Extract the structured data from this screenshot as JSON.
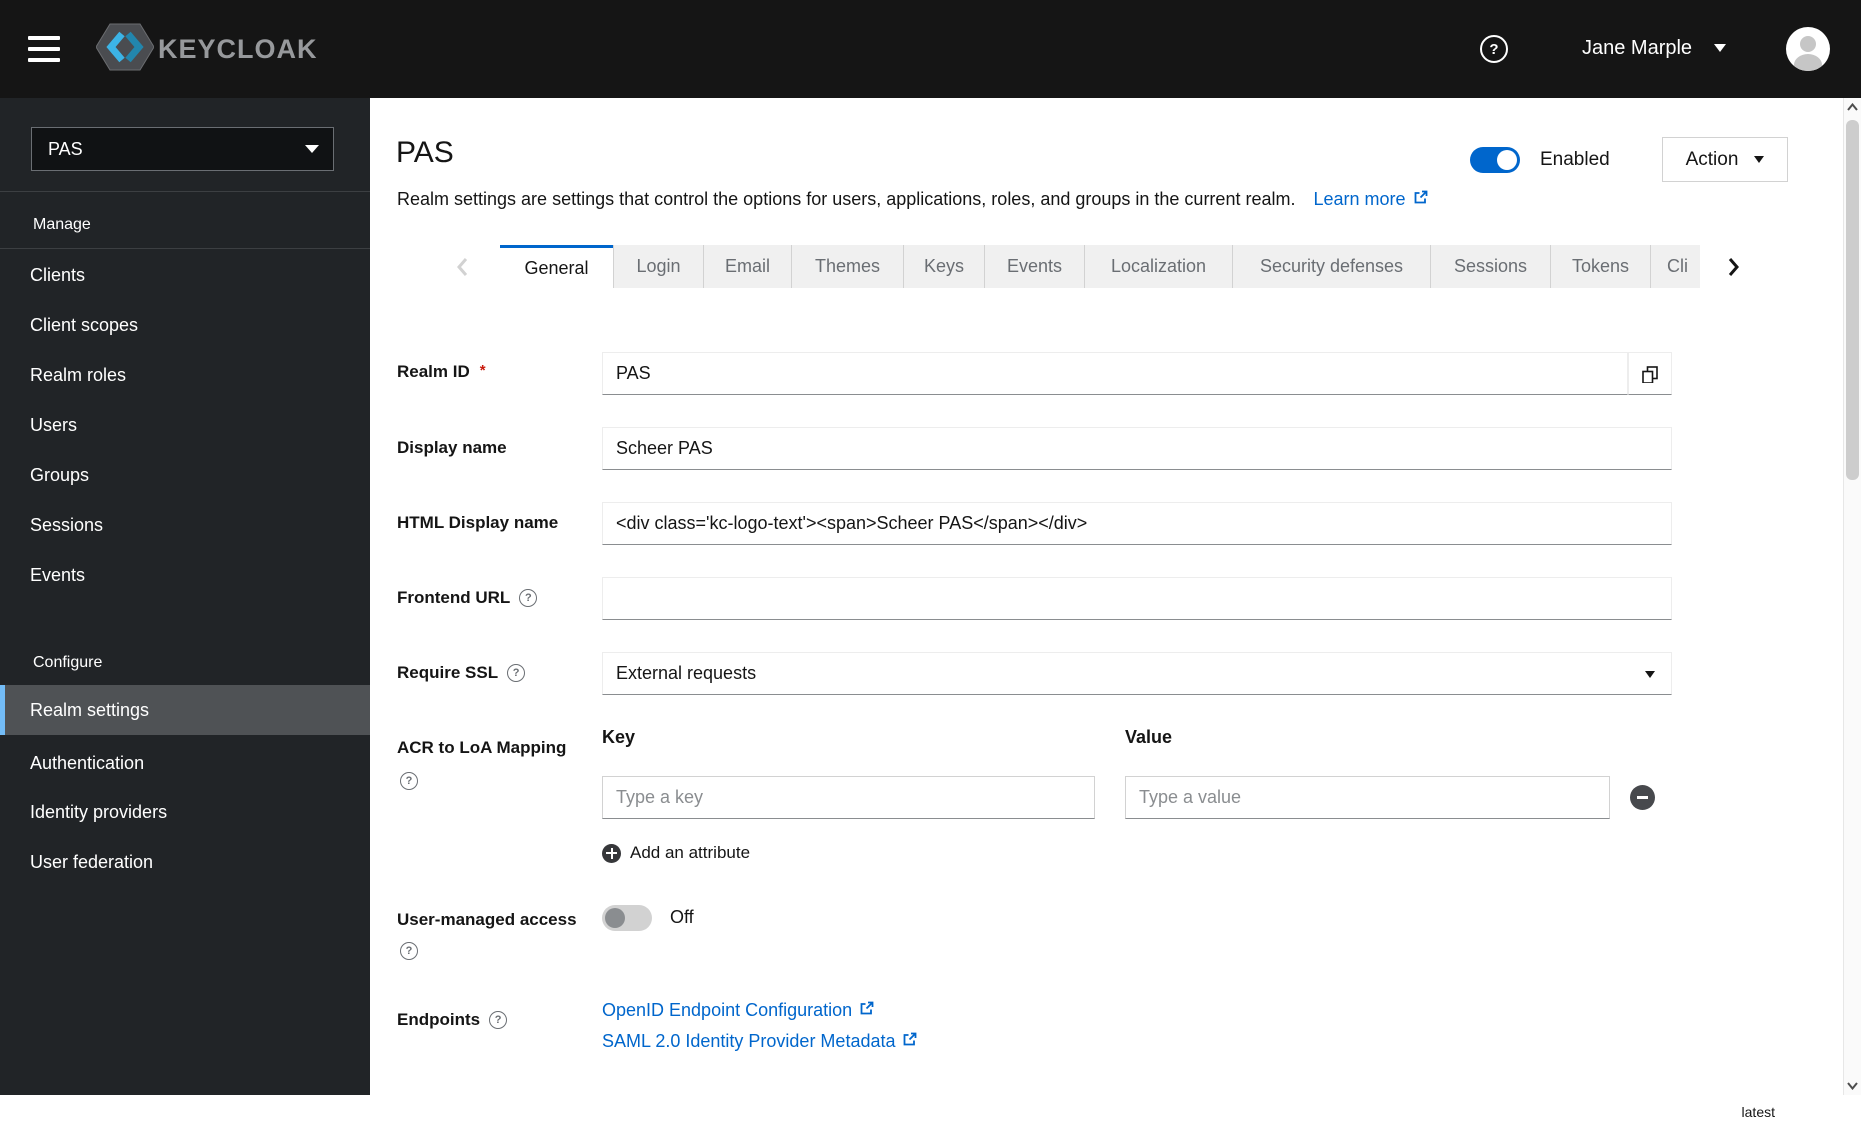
{
  "masthead": {
    "logo_text": "KEYCLOAK",
    "user_name": "Jane Marple"
  },
  "sidebar": {
    "realm": "PAS",
    "manage_label": "Manage",
    "manage_items": [
      "Clients",
      "Client scopes",
      "Realm roles",
      "Users",
      "Groups",
      "Sessions",
      "Events"
    ],
    "configure_label": "Configure",
    "configure_items": [
      "Realm settings",
      "Authentication",
      "Identity providers",
      "User federation"
    ],
    "selected_item": "Realm settings"
  },
  "header": {
    "title": "PAS",
    "description": "Realm settings are settings that control the options for users, applications, roles, and groups in the current realm.",
    "learn_more_label": "Learn more",
    "enabled_label": "Enabled",
    "enabled_state": "on",
    "action_label": "Action"
  },
  "tabs": [
    "General",
    "Login",
    "Email",
    "Themes",
    "Keys",
    "Events",
    "Localization",
    "Security defenses",
    "Sessions",
    "Tokens",
    "Cli"
  ],
  "active_tab": "General",
  "form": {
    "realm_id": {
      "label": "Realm ID",
      "value": "PAS",
      "required": "*"
    },
    "display_name": {
      "label": "Display name",
      "value": "Scheer PAS"
    },
    "html_display_name": {
      "label": "HTML Display name",
      "value": "<div class='kc-logo-text'><span>Scheer PAS</span></div>"
    },
    "frontend_url": {
      "label": "Frontend URL",
      "value": ""
    },
    "require_ssl": {
      "label": "Require SSL",
      "value": "External requests"
    },
    "acr_mapping": {
      "label": "ACR to LoA Mapping",
      "key_header": "Key",
      "value_header": "Value",
      "key_placeholder": "Type a key",
      "value_placeholder": "Type a value",
      "add_label": "Add an attribute"
    },
    "user_managed_access": {
      "label": "User-managed access",
      "state": "Off"
    },
    "endpoints": {
      "label": "Endpoints",
      "links": [
        "OpenID Endpoint Configuration",
        "SAML 2.0 Identity Provider Metadata"
      ]
    }
  },
  "footer": {
    "version": "latest"
  },
  "colors": {
    "accent": "#0066cc",
    "masthead_bg": "#151515",
    "sidebar_bg": "#212427",
    "sidebar_selected_bg": "#4f5255",
    "sidebar_selected_accent": "#73bcf7",
    "link": "#0066cc",
    "required_red": "#c9190b",
    "tab_inactive_bg": "#f0f0f0",
    "tab_text": "#6a6e73",
    "input_bottom_border": "#8a8d90"
  }
}
